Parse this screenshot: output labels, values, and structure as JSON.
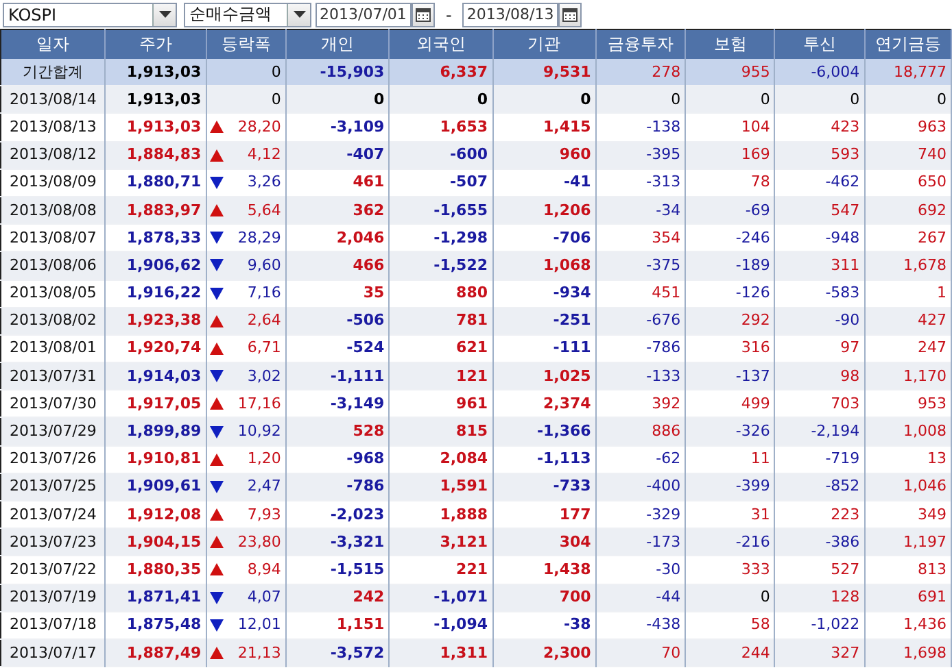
{
  "toolbar": {
    "market": "KOSPI",
    "measure": "순매수금액",
    "date_from": "2013/07/01",
    "separator": "-",
    "date_to": "2013/08/13"
  },
  "table": {
    "columns": [
      "일자",
      "주가",
      "등락폭",
      "개인",
      "외국인",
      "기관",
      "금융투자",
      "보험",
      "투신",
      "연기금등"
    ],
    "rows": [
      {
        "kind": "total",
        "cells": [
          {
            "text": "기간합계"
          },
          {
            "text": "1,913,03",
            "color": "#000000"
          },
          {
            "text": "0",
            "color": "#000000"
          },
          {
            "text": "-15,903",
            "color": "#1a1aa0"
          },
          {
            "text": "6,337",
            "color": "#c8101a"
          },
          {
            "text": "9,531",
            "color": "#c8101a"
          },
          {
            "text": "278",
            "color": "#c8101a"
          },
          {
            "text": "955",
            "color": "#c8101a"
          },
          {
            "text": "-6,004",
            "color": "#1a1aa0"
          },
          {
            "text": "18,777",
            "color": "#c8101a"
          }
        ]
      },
      {
        "kind": "day",
        "cells": [
          {
            "text": "2013/08/14"
          },
          {
            "text": "1,913,03",
            "color": "#000000"
          },
          {
            "text": "0",
            "color": "#000000"
          },
          {
            "text": "0",
            "color": "#000000"
          },
          {
            "text": "0",
            "color": "#000000"
          },
          {
            "text": "0",
            "color": "#000000"
          },
          {
            "text": "0",
            "color": "#000000"
          },
          {
            "text": "0",
            "color": "#000000"
          },
          {
            "text": "0",
            "color": "#000000"
          },
          {
            "text": "0",
            "color": "#000000"
          }
        ]
      },
      {
        "kind": "day",
        "cells": [
          {
            "text": "2013/08/13"
          },
          {
            "text": "1,913,03",
            "color": "#c8101a"
          },
          {
            "text": "28,20",
            "color": "#c8101a",
            "rising": true
          },
          {
            "text": "-3,109",
            "color": "#1a1aa0"
          },
          {
            "text": "1,653",
            "color": "#c8101a"
          },
          {
            "text": "1,415",
            "color": "#c8101a"
          },
          {
            "text": "-138",
            "color": "#1a1aa0"
          },
          {
            "text": "104",
            "color": "#c8101a"
          },
          {
            "text": "423",
            "color": "#c8101a"
          },
          {
            "text": "963",
            "color": "#c8101a"
          }
        ]
      },
      {
        "kind": "day",
        "cells": [
          {
            "text": "2013/08/12"
          },
          {
            "text": "1,884,83",
            "color": "#c8101a"
          },
          {
            "text": "4,12",
            "color": "#c8101a",
            "rising": true
          },
          {
            "text": "-407",
            "color": "#1a1aa0"
          },
          {
            "text": "-600",
            "color": "#1a1aa0"
          },
          {
            "text": "960",
            "color": "#c8101a"
          },
          {
            "text": "-395",
            "color": "#1a1aa0"
          },
          {
            "text": "169",
            "color": "#c8101a"
          },
          {
            "text": "593",
            "color": "#c8101a"
          },
          {
            "text": "740",
            "color": "#c8101a"
          }
        ]
      },
      {
        "kind": "day",
        "cells": [
          {
            "text": "2013/08/09"
          },
          {
            "text": "1,880,71",
            "color": "#1a1aa0"
          },
          {
            "text": "3,26",
            "color": "#1a1aa0",
            "rising": false
          },
          {
            "text": "461",
            "color": "#c8101a"
          },
          {
            "text": "-507",
            "color": "#1a1aa0"
          },
          {
            "text": "-41",
            "color": "#1a1aa0"
          },
          {
            "text": "-313",
            "color": "#1a1aa0"
          },
          {
            "text": "78",
            "color": "#c8101a"
          },
          {
            "text": "-462",
            "color": "#1a1aa0"
          },
          {
            "text": "650",
            "color": "#c8101a"
          }
        ]
      },
      {
        "kind": "day",
        "cells": [
          {
            "text": "2013/08/08"
          },
          {
            "text": "1,883,97",
            "color": "#c8101a"
          },
          {
            "text": "5,64",
            "color": "#c8101a",
            "rising": true
          },
          {
            "text": "362",
            "color": "#c8101a"
          },
          {
            "text": "-1,655",
            "color": "#1a1aa0"
          },
          {
            "text": "1,206",
            "color": "#c8101a"
          },
          {
            "text": "-34",
            "color": "#1a1aa0"
          },
          {
            "text": "-69",
            "color": "#1a1aa0"
          },
          {
            "text": "547",
            "color": "#c8101a"
          },
          {
            "text": "692",
            "color": "#c8101a"
          }
        ]
      },
      {
        "kind": "day",
        "cells": [
          {
            "text": "2013/08/07"
          },
          {
            "text": "1,878,33",
            "color": "#1a1aa0"
          },
          {
            "text": "28,29",
            "color": "#1a1aa0",
            "rising": false
          },
          {
            "text": "2,046",
            "color": "#c8101a"
          },
          {
            "text": "-1,298",
            "color": "#1a1aa0"
          },
          {
            "text": "-706",
            "color": "#1a1aa0"
          },
          {
            "text": "354",
            "color": "#c8101a"
          },
          {
            "text": "-246",
            "color": "#1a1aa0"
          },
          {
            "text": "-948",
            "color": "#1a1aa0"
          },
          {
            "text": "267",
            "color": "#c8101a"
          }
        ]
      },
      {
        "kind": "day",
        "cells": [
          {
            "text": "2013/08/06"
          },
          {
            "text": "1,906,62",
            "color": "#1a1aa0"
          },
          {
            "text": "9,60",
            "color": "#1a1aa0",
            "rising": false
          },
          {
            "text": "466",
            "color": "#c8101a"
          },
          {
            "text": "-1,522",
            "color": "#1a1aa0"
          },
          {
            "text": "1,068",
            "color": "#c8101a"
          },
          {
            "text": "-375",
            "color": "#1a1aa0"
          },
          {
            "text": "-189",
            "color": "#1a1aa0"
          },
          {
            "text": "311",
            "color": "#c8101a"
          },
          {
            "text": "1,678",
            "color": "#c8101a"
          }
        ]
      },
      {
        "kind": "day",
        "cells": [
          {
            "text": "2013/08/05"
          },
          {
            "text": "1,916,22",
            "color": "#1a1aa0"
          },
          {
            "text": "7,16",
            "color": "#1a1aa0",
            "rising": false
          },
          {
            "text": "35",
            "color": "#c8101a"
          },
          {
            "text": "880",
            "color": "#c8101a"
          },
          {
            "text": "-934",
            "color": "#1a1aa0"
          },
          {
            "text": "451",
            "color": "#c8101a"
          },
          {
            "text": "-126",
            "color": "#1a1aa0"
          },
          {
            "text": "-583",
            "color": "#1a1aa0"
          },
          {
            "text": "1",
            "color": "#c8101a"
          }
        ]
      },
      {
        "kind": "day",
        "cells": [
          {
            "text": "2013/08/02"
          },
          {
            "text": "1,923,38",
            "color": "#c8101a"
          },
          {
            "text": "2,64",
            "color": "#c8101a",
            "rising": true
          },
          {
            "text": "-506",
            "color": "#1a1aa0"
          },
          {
            "text": "781",
            "color": "#c8101a"
          },
          {
            "text": "-251",
            "color": "#1a1aa0"
          },
          {
            "text": "-676",
            "color": "#1a1aa0"
          },
          {
            "text": "292",
            "color": "#c8101a"
          },
          {
            "text": "-90",
            "color": "#1a1aa0"
          },
          {
            "text": "427",
            "color": "#c8101a"
          }
        ]
      },
      {
        "kind": "day",
        "cells": [
          {
            "text": "2013/08/01"
          },
          {
            "text": "1,920,74",
            "color": "#c8101a"
          },
          {
            "text": "6,71",
            "color": "#c8101a",
            "rising": true
          },
          {
            "text": "-524",
            "color": "#1a1aa0"
          },
          {
            "text": "621",
            "color": "#c8101a"
          },
          {
            "text": "-111",
            "color": "#1a1aa0"
          },
          {
            "text": "-786",
            "color": "#1a1aa0"
          },
          {
            "text": "316",
            "color": "#c8101a"
          },
          {
            "text": "97",
            "color": "#c8101a"
          },
          {
            "text": "247",
            "color": "#c8101a"
          }
        ]
      },
      {
        "kind": "day",
        "cells": [
          {
            "text": "2013/07/31"
          },
          {
            "text": "1,914,03",
            "color": "#1a1aa0"
          },
          {
            "text": "3,02",
            "color": "#1a1aa0",
            "rising": false
          },
          {
            "text": "-1,111",
            "color": "#1a1aa0"
          },
          {
            "text": "121",
            "color": "#c8101a"
          },
          {
            "text": "1,025",
            "color": "#c8101a"
          },
          {
            "text": "-133",
            "color": "#1a1aa0"
          },
          {
            "text": "-137",
            "color": "#1a1aa0"
          },
          {
            "text": "98",
            "color": "#c8101a"
          },
          {
            "text": "1,170",
            "color": "#c8101a"
          }
        ]
      },
      {
        "kind": "day",
        "cells": [
          {
            "text": "2013/07/30"
          },
          {
            "text": "1,917,05",
            "color": "#c8101a"
          },
          {
            "text": "17,16",
            "color": "#c8101a",
            "rising": true
          },
          {
            "text": "-3,149",
            "color": "#1a1aa0"
          },
          {
            "text": "961",
            "color": "#c8101a"
          },
          {
            "text": "2,374",
            "color": "#c8101a"
          },
          {
            "text": "392",
            "color": "#c8101a"
          },
          {
            "text": "499",
            "color": "#c8101a"
          },
          {
            "text": "703",
            "color": "#c8101a"
          },
          {
            "text": "953",
            "color": "#c8101a"
          }
        ]
      },
      {
        "kind": "day",
        "cells": [
          {
            "text": "2013/07/29"
          },
          {
            "text": "1,899,89",
            "color": "#1a1aa0"
          },
          {
            "text": "10,92",
            "color": "#1a1aa0",
            "rising": false
          },
          {
            "text": "528",
            "color": "#c8101a"
          },
          {
            "text": "815",
            "color": "#c8101a"
          },
          {
            "text": "-1,366",
            "color": "#1a1aa0"
          },
          {
            "text": "886",
            "color": "#c8101a"
          },
          {
            "text": "-326",
            "color": "#1a1aa0"
          },
          {
            "text": "-2,194",
            "color": "#1a1aa0"
          },
          {
            "text": "1,008",
            "color": "#c8101a"
          }
        ]
      },
      {
        "kind": "day",
        "cells": [
          {
            "text": "2013/07/26"
          },
          {
            "text": "1,910,81",
            "color": "#c8101a"
          },
          {
            "text": "1,20",
            "color": "#c8101a",
            "rising": true
          },
          {
            "text": "-968",
            "color": "#1a1aa0"
          },
          {
            "text": "2,084",
            "color": "#c8101a"
          },
          {
            "text": "-1,113",
            "color": "#1a1aa0"
          },
          {
            "text": "-62",
            "color": "#1a1aa0"
          },
          {
            "text": "11",
            "color": "#c8101a"
          },
          {
            "text": "-719",
            "color": "#1a1aa0"
          },
          {
            "text": "13",
            "color": "#c8101a"
          }
        ]
      },
      {
        "kind": "day",
        "cells": [
          {
            "text": "2013/07/25"
          },
          {
            "text": "1,909,61",
            "color": "#1a1aa0"
          },
          {
            "text": "2,47",
            "color": "#1a1aa0",
            "rising": false
          },
          {
            "text": "-786",
            "color": "#1a1aa0"
          },
          {
            "text": "1,591",
            "color": "#c8101a"
          },
          {
            "text": "-733",
            "color": "#1a1aa0"
          },
          {
            "text": "-400",
            "color": "#1a1aa0"
          },
          {
            "text": "-399",
            "color": "#1a1aa0"
          },
          {
            "text": "-852",
            "color": "#1a1aa0"
          },
          {
            "text": "1,046",
            "color": "#c8101a"
          }
        ]
      },
      {
        "kind": "day",
        "cells": [
          {
            "text": "2013/07/24"
          },
          {
            "text": "1,912,08",
            "color": "#c8101a"
          },
          {
            "text": "7,93",
            "color": "#c8101a",
            "rising": true
          },
          {
            "text": "-2,023",
            "color": "#1a1aa0"
          },
          {
            "text": "1,888",
            "color": "#c8101a"
          },
          {
            "text": "177",
            "color": "#c8101a"
          },
          {
            "text": "-329",
            "color": "#1a1aa0"
          },
          {
            "text": "31",
            "color": "#c8101a"
          },
          {
            "text": "223",
            "color": "#c8101a"
          },
          {
            "text": "349",
            "color": "#c8101a"
          }
        ]
      },
      {
        "kind": "day",
        "cells": [
          {
            "text": "2013/07/23"
          },
          {
            "text": "1,904,15",
            "color": "#c8101a"
          },
          {
            "text": "23,80",
            "color": "#c8101a",
            "rising": true
          },
          {
            "text": "-3,321",
            "color": "#1a1aa0"
          },
          {
            "text": "3,121",
            "color": "#c8101a"
          },
          {
            "text": "304",
            "color": "#c8101a"
          },
          {
            "text": "-173",
            "color": "#1a1aa0"
          },
          {
            "text": "-216",
            "color": "#1a1aa0"
          },
          {
            "text": "-386",
            "color": "#1a1aa0"
          },
          {
            "text": "1,197",
            "color": "#c8101a"
          }
        ]
      },
      {
        "kind": "day",
        "cells": [
          {
            "text": "2013/07/22"
          },
          {
            "text": "1,880,35",
            "color": "#c8101a"
          },
          {
            "text": "8,94",
            "color": "#c8101a",
            "rising": true
          },
          {
            "text": "-1,515",
            "color": "#1a1aa0"
          },
          {
            "text": "221",
            "color": "#c8101a"
          },
          {
            "text": "1,438",
            "color": "#c8101a"
          },
          {
            "text": "-30",
            "color": "#1a1aa0"
          },
          {
            "text": "333",
            "color": "#c8101a"
          },
          {
            "text": "527",
            "color": "#c8101a"
          },
          {
            "text": "813",
            "color": "#c8101a"
          }
        ]
      },
      {
        "kind": "day",
        "cells": [
          {
            "text": "2013/07/19"
          },
          {
            "text": "1,871,41",
            "color": "#1a1aa0"
          },
          {
            "text": "4,07",
            "color": "#1a1aa0",
            "rising": false
          },
          {
            "text": "242",
            "color": "#c8101a"
          },
          {
            "text": "-1,071",
            "color": "#1a1aa0"
          },
          {
            "text": "700",
            "color": "#c8101a"
          },
          {
            "text": "-44",
            "color": "#1a1aa0"
          },
          {
            "text": "0",
            "color": "#000000"
          },
          {
            "text": "128",
            "color": "#c8101a"
          },
          {
            "text": "691",
            "color": "#c8101a"
          }
        ]
      },
      {
        "kind": "day",
        "cells": [
          {
            "text": "2013/07/18"
          },
          {
            "text": "1,875,48",
            "color": "#1a1aa0"
          },
          {
            "text": "12,01",
            "color": "#1a1aa0",
            "rising": false
          },
          {
            "text": "1,151",
            "color": "#c8101a"
          },
          {
            "text": "-1,094",
            "color": "#1a1aa0"
          },
          {
            "text": "-38",
            "color": "#1a1aa0"
          },
          {
            "text": "-438",
            "color": "#1a1aa0"
          },
          {
            "text": "58",
            "color": "#c8101a"
          },
          {
            "text": "-1,022",
            "color": "#1a1aa0"
          },
          {
            "text": "1,436",
            "color": "#c8101a"
          }
        ]
      },
      {
        "kind": "day",
        "cells": [
          {
            "text": "2013/07/17"
          },
          {
            "text": "1,887,49",
            "color": "#c8101a"
          },
          {
            "text": "21,13",
            "color": "#c8101a",
            "rising": true
          },
          {
            "text": "-3,572",
            "color": "#1a1aa0"
          },
          {
            "text": "1,311",
            "color": "#c8101a"
          },
          {
            "text": "2,300",
            "color": "#c8101a"
          },
          {
            "text": "70",
            "color": "#c8101a"
          },
          {
            "text": "244",
            "color": "#c8101a"
          },
          {
            "text": "327",
            "color": "#c8101a"
          },
          {
            "text": "1,698",
            "color": "#c8101a"
          }
        ]
      }
    ]
  }
}
